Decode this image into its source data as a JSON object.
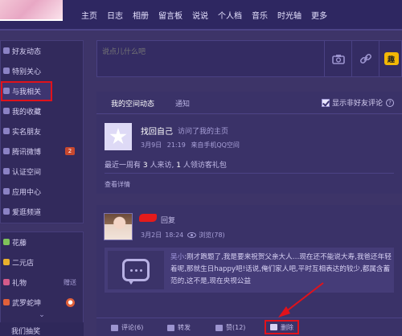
{
  "nav": {
    "items": [
      "主页",
      "日志",
      "相册",
      "留言板",
      "说说",
      "个人档",
      "音乐",
      "时光轴",
      "更多"
    ]
  },
  "sidebar": {
    "items": [
      {
        "label": "好友动态"
      },
      {
        "label": "特别关心"
      },
      {
        "label": "与我相关",
        "active": true
      },
      {
        "label": "我的收藏"
      },
      {
        "label": "实名朋友"
      },
      {
        "label": "腾讯微博",
        "badge": "2"
      },
      {
        "label": "认证空间"
      },
      {
        "label": "应用中心"
      },
      {
        "label": "爱逛频道"
      }
    ],
    "apps": [
      {
        "label": "花藤"
      },
      {
        "label": "二元店"
      },
      {
        "label": "礼物",
        "extra": "赠送"
      },
      {
        "label": "武罗蛇坤"
      }
    ],
    "more_icon": "chevron-down-icon",
    "last_label": "我们抽奖"
  },
  "post": {
    "placeholder": "说点儿什么吧",
    "tools": [
      "camera-icon",
      "link-icon",
      "fun-icon"
    ],
    "fun_label": "趣"
  },
  "feed": {
    "tab_mine": "我的空间动态",
    "tab_notify": "通知",
    "show_non_friend": "显示非好友评论"
  },
  "visit_card": {
    "name": "找回自己",
    "action": "访问了我的主页",
    "time": "3月9日",
    "clock": "21:19",
    "source": "来自手机QQ空间",
    "stats_prefix": "最近一周有",
    "stats_visitors": "3",
    "stats_mid": "人来访,",
    "stats_gifts": "1",
    "stats_suffix": "人领访客礼包",
    "detail_link": "查看详情"
  },
  "reply_card": {
    "reply_label": "回复",
    "date": "3月2日",
    "time": "18:24",
    "views": "浏览(78)",
    "quote_author": "吴小",
    "quote_body": ":刚才跑题了,我是要来祝贺父亲大人…现在还不能说大寿,我爸还年轻着呢,那就生日happy吧!话说,俺们家人吧,平时互相表达的较少,都属含蓄范的,这不是,现在央视公益",
    "actions": {
      "comment": "评论(6)",
      "forward": "转发",
      "like": "赞(12)",
      "delete": "删除"
    }
  },
  "colors": {
    "background": "#3d3468",
    "highlight_red": "#e0121b",
    "badge": "#c8482e"
  }
}
